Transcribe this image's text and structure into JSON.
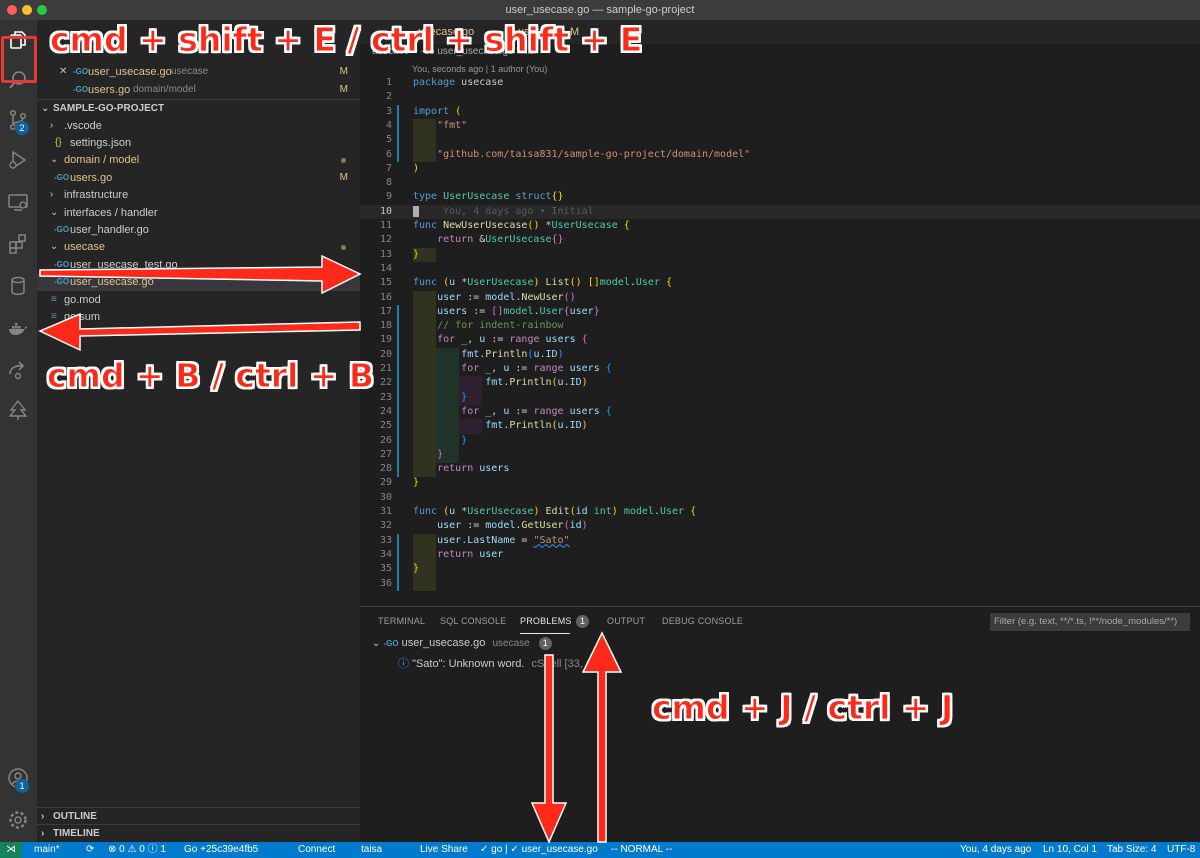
{
  "window": {
    "title": "user_usecase.go — sample-go-project"
  },
  "activity_bar": {
    "scm_badge": "2",
    "accounts_badge": "1"
  },
  "sidebar": {
    "open_editors": [
      {
        "name": "user_usecase.go",
        "desc": "usecase",
        "status": "M"
      },
      {
        "name": "users.go",
        "desc": "domain/model",
        "status": "M"
      }
    ],
    "project_title": "SAMPLE-GO-PROJECT",
    "tree": [
      {
        "name": ".vscode"
      },
      {
        "name": "settings.json"
      },
      {
        "name": "domain / model"
      },
      {
        "name": "users.go",
        "status": "M"
      },
      {
        "name": "infrastructure"
      },
      {
        "name": "interfaces / handler"
      },
      {
        "name": "user_handler.go"
      },
      {
        "name": "usecase"
      },
      {
        "name": "user_usecase_test.go"
      },
      {
        "name": "user_usecase.go"
      },
      {
        "name": "go.mod"
      },
      {
        "name": "go.sum"
      }
    ],
    "outline": "OUTLINE",
    "timeline": "TIMELINE"
  },
  "editor": {
    "tabs": [
      {
        "label": "usecase.go",
        "status": ""
      },
      {
        "label": "users.go",
        "status": "M"
      }
    ],
    "breadcrumb": "usecase > -co user_usecase.go > ...",
    "codelens": "You, seconds ago | 1 author (You)",
    "blame": "You, 4 days ago • Initial",
    "line_numbers": [
      "1",
      "2",
      "3",
      "4",
      "5",
      "6",
      "7",
      "8",
      "9",
      "10",
      "11",
      "12",
      "13",
      "14",
      "15",
      "16",
      "17",
      "18",
      "19",
      "20",
      "21",
      "22",
      "23",
      "24",
      "25",
      "26",
      "27",
      "28",
      "29",
      "30",
      "31",
      "32",
      "33",
      "34",
      "35",
      "36"
    ]
  },
  "panel": {
    "tabs": [
      "TERMINAL",
      "SQL CONSOLE",
      "PROBLEMS",
      "OUTPUT",
      "DEBUG CONSOLE"
    ],
    "problems_count": "1",
    "filter_placeholder": "Filter (e.g. text, **/*.ts, !**/node_modules/**)",
    "file": "user_usecase.go",
    "file_desc": "usecase",
    "file_count": "1",
    "problem": "\"Sato\": Unknown word.",
    "problem_source": "cSpell  [33, 19]"
  },
  "status_bar": {
    "branch": "main*",
    "errors": "⊗ 0 ⚠ 0 ⓘ 1",
    "go_version": "Go +25c39e4fb5",
    "connect": "Connect",
    "user": "taisa",
    "live_share": "Live Share",
    "go_check": "✓ go | ✓ user_usecase.go",
    "vim_mode": "-- NORMAL --",
    "blame": "You, 4 days ago",
    "cursor": "Ln 10, Col 1",
    "tab_size": "Tab Size: 4",
    "encoding": "UTF-8"
  },
  "annotations": {
    "explorer": "cmd + shift + E / ctrl + shift + E",
    "sidebar": "cmd + B / ctrl + B",
    "panel": "cmd + J / ctrl + J"
  },
  "colors": {
    "accent": "#007acc",
    "annotation": "#ff2a1a",
    "modified": "#e2c08d"
  }
}
